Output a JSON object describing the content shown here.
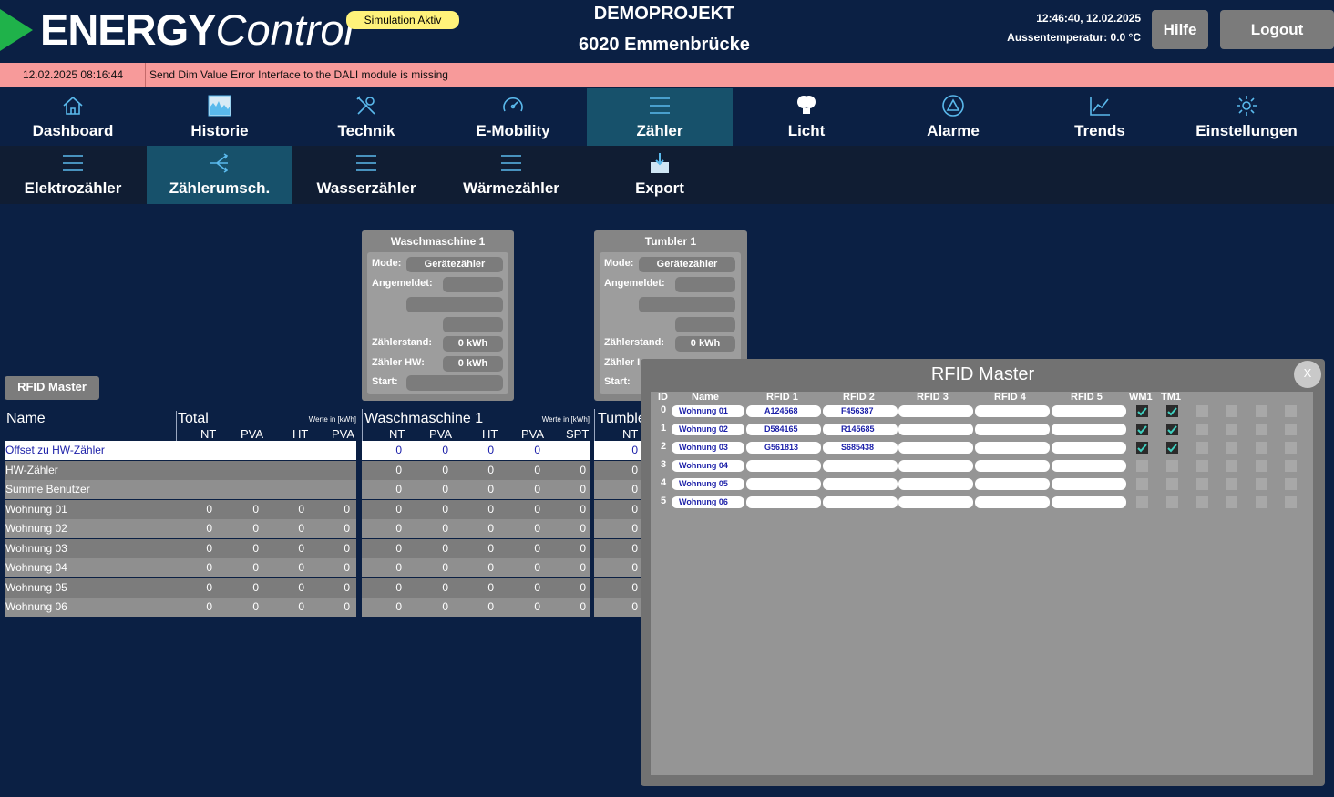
{
  "header": {
    "logo_bold": "ENERGY",
    "logo_light": "Control",
    "badge": "Simulation Aktiv",
    "project_title": "DEMOPROJEKT",
    "project_location": "6020 Emmenbrücke",
    "time": "12:46:40, 12.02.2025",
    "temperature": "Aussentemperatur: 0.0 °C",
    "help_label": "Hilfe",
    "logout_label": "Logout"
  },
  "error": {
    "timestamp": "12.02.2025 08:16:44",
    "message": "Send Dim Value Error  Interface to the DALI module is missing"
  },
  "nav_main": [
    {
      "label": "Dashboard",
      "icon": "home-icon"
    },
    {
      "label": "Historie",
      "icon": "history-chart-icon"
    },
    {
      "label": "Technik",
      "icon": "tools-icon"
    },
    {
      "label": "E-Mobility",
      "icon": "gauge-icon"
    },
    {
      "label": "Zähler",
      "icon": "list-icon",
      "active": true
    },
    {
      "label": "Licht",
      "icon": "bulb-icon"
    },
    {
      "label": "Alarme",
      "icon": "alarm-icon"
    },
    {
      "label": "Trends",
      "icon": "trend-icon"
    },
    {
      "label": "Einstellungen",
      "icon": "gear-icon"
    }
  ],
  "nav_sub": [
    {
      "label": "Elektrozähler",
      "icon": "list-icon"
    },
    {
      "label": "Zählerumsch.",
      "icon": "switch-icon",
      "active": true
    },
    {
      "label": "Wasserzähler",
      "icon": "list-icon"
    },
    {
      "label": "Wärmezähler",
      "icon": "list-icon"
    },
    {
      "label": "Export",
      "icon": "export-icon"
    }
  ],
  "devices": [
    {
      "title": "Waschmaschine 1",
      "mode_label": "Mode:",
      "mode_value": "Gerätezähler",
      "registered_label": "Angemeldet:",
      "meter_label": "Zählerstand:",
      "meter_value": "0 kWh",
      "hw_label": "Zähler HW:",
      "hw_value": "0 kWh",
      "start_label": "Start:"
    },
    {
      "title": "Tumbler 1",
      "mode_label": "Mode:",
      "mode_value": "Gerätezähler",
      "registered_label": "Angemeldet:",
      "meter_label": "Zählerstand:",
      "meter_value": "0 kWh",
      "hw_label": "Zähler I",
      "start_label": "Start:"
    }
  ],
  "rfid_button": "RFID Master",
  "table": {
    "name_header": "Name",
    "units_note": "Werte in [kWh]",
    "total_header": "Total",
    "wm_header": "Waschmaschine 1",
    "tumbler_header": "Tumble",
    "cols_total": [
      "NT",
      "PVA",
      "HT",
      "PVA"
    ],
    "cols_wm": [
      "NT",
      "PVA",
      "HT",
      "PVA",
      "SPT"
    ],
    "cols_tumbler": [
      "NT"
    ],
    "rows": [
      {
        "name": "Offset zu HW-Zähler",
        "total": [
          "",
          "",
          "",
          ""
        ],
        "wm": [
          "0",
          "0",
          "0",
          "0",
          ""
        ],
        "tb": "0"
      },
      {
        "name": "HW-Zähler",
        "total": [
          "",
          "",
          "",
          ""
        ],
        "wm": [
          "0",
          "0",
          "0",
          "0",
          "0"
        ],
        "tb": "0"
      },
      {
        "name": "Summe Benutzer",
        "total": [
          "",
          "",
          "",
          ""
        ],
        "wm": [
          "0",
          "0",
          "0",
          "0",
          "0"
        ],
        "tb": "0"
      },
      {
        "name": "Wohnung 01",
        "total": [
          "0",
          "0",
          "0",
          "0"
        ],
        "wm": [
          "0",
          "0",
          "0",
          "0",
          "0"
        ],
        "tb": "0"
      },
      {
        "name": "Wohnung 02",
        "total": [
          "0",
          "0",
          "0",
          "0"
        ],
        "wm": [
          "0",
          "0",
          "0",
          "0",
          "0"
        ],
        "tb": "0"
      },
      {
        "name": "Wohnung 03",
        "total": [
          "0",
          "0",
          "0",
          "0"
        ],
        "wm": [
          "0",
          "0",
          "0",
          "0",
          "0"
        ],
        "tb": "0"
      },
      {
        "name": "Wohnung 04",
        "total": [
          "0",
          "0",
          "0",
          "0"
        ],
        "wm": [
          "0",
          "0",
          "0",
          "0",
          "0"
        ],
        "tb": "0"
      },
      {
        "name": "Wohnung 05",
        "total": [
          "0",
          "0",
          "0",
          "0"
        ],
        "wm": [
          "0",
          "0",
          "0",
          "0",
          "0"
        ],
        "tb": "0"
      },
      {
        "name": "Wohnung 06",
        "total": [
          "0",
          "0",
          "0",
          "0"
        ],
        "wm": [
          "0",
          "0",
          "0",
          "0",
          "0"
        ],
        "tb": "0"
      }
    ]
  },
  "modal": {
    "title": "RFID Master",
    "close_label": "X",
    "headers": [
      "ID",
      "Name",
      "RFID 1",
      "RFID 2",
      "RFID 3",
      "RFID 4",
      "RFID 5",
      "WM1",
      "TM1"
    ],
    "rows": [
      {
        "id": "0",
        "name": "Wohnung 01",
        "rfid": [
          "A124568",
          "F456387",
          "",
          "",
          ""
        ],
        "checks": [
          true,
          true,
          false,
          false,
          false,
          false,
          false
        ]
      },
      {
        "id": "1",
        "name": "Wohnung 02",
        "rfid": [
          "D584165",
          "R145685",
          "",
          "",
          ""
        ],
        "checks": [
          true,
          true,
          false,
          false,
          false,
          false,
          false
        ]
      },
      {
        "id": "2",
        "name": "Wohnung 03",
        "rfid": [
          "G561813",
          "S685438",
          "",
          "",
          ""
        ],
        "checks": [
          true,
          true,
          false,
          false,
          false,
          false,
          false
        ]
      },
      {
        "id": "3",
        "name": "Wohnung 04",
        "rfid": [
          "",
          "",
          "",
          "",
          ""
        ],
        "checks": [
          false,
          false,
          false,
          false,
          false,
          false,
          false
        ]
      },
      {
        "id": "4",
        "name": "Wohnung 05",
        "rfid": [
          "",
          "",
          "",
          "",
          ""
        ],
        "checks": [
          false,
          false,
          false,
          false,
          false,
          false,
          false
        ]
      },
      {
        "id": "5",
        "name": "Wohnung 06",
        "rfid": [
          "",
          "",
          "",
          "",
          ""
        ],
        "checks": [
          false,
          false,
          false,
          false,
          false,
          false,
          false
        ]
      }
    ]
  },
  "colors": {
    "background": "#0b2044",
    "accent_green": "#1fb24a",
    "icon_blue": "#5ab9ec",
    "active_tab": "#17516b",
    "error_bar": "#f79a9a",
    "badge_yellow": "#fff27a",
    "check_teal": "#3fd0c0"
  }
}
